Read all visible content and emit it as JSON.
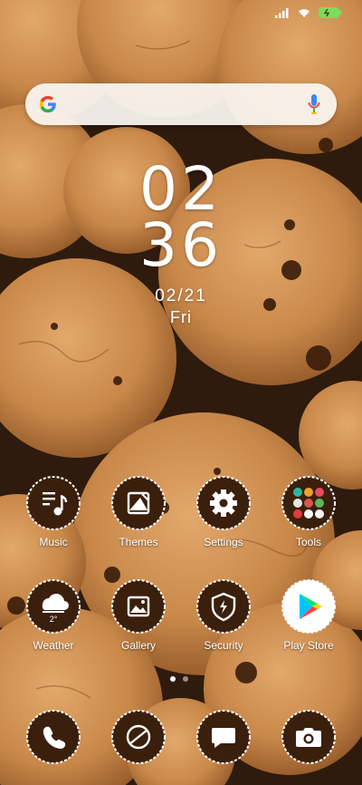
{
  "status": {
    "battery_color": "#7ddc5a"
  },
  "search": {
    "placeholder": ""
  },
  "clock": {
    "hour": "02",
    "minute": "36",
    "date": "02/21",
    "day": "Fri"
  },
  "apps_row1": [
    {
      "label": "Music",
      "icon": "music-icon"
    },
    {
      "label": "Themes",
      "icon": "themes-icon"
    },
    {
      "label": "Settings",
      "icon": "settings-icon"
    },
    {
      "label": "Tools",
      "icon": "tools-folder-icon"
    }
  ],
  "apps_row2": [
    {
      "label": "Weather",
      "icon": "weather-icon",
      "badge": "2°"
    },
    {
      "label": "Gallery",
      "icon": "gallery-icon"
    },
    {
      "label": "Security",
      "icon": "security-icon"
    },
    {
      "label": "Play Store",
      "icon": "play-store-icon"
    }
  ],
  "dock": [
    {
      "icon": "phone-icon"
    },
    {
      "icon": "browser-icon"
    },
    {
      "icon": "messages-icon"
    },
    {
      "icon": "camera-icon"
    }
  ],
  "pages": {
    "count": 2,
    "active": 0
  },
  "colors": {
    "icon_dark": "#3b1f0d",
    "cookie": "#c98a4a",
    "background": "#3a2412"
  }
}
